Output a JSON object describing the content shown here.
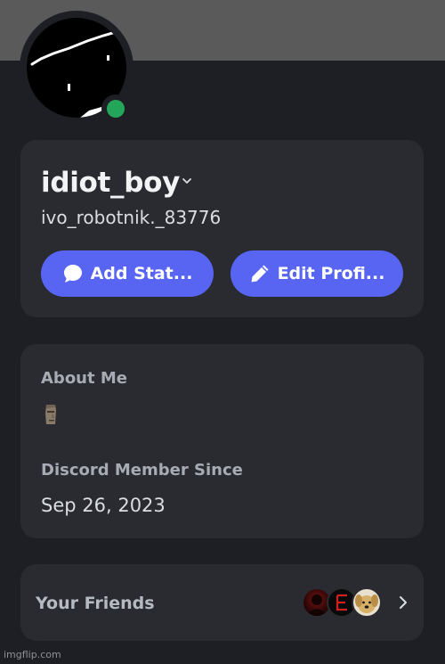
{
  "profile": {
    "display_name": "idiot_boy",
    "username": "ivo_robotnik._83776",
    "status": "online",
    "status_color": "#23a55a",
    "banner_color": "#5a5a5a"
  },
  "buttons": {
    "add_status": "Add Stat...",
    "edit_profile": "Edit Profi..."
  },
  "about": {
    "heading": "About Me",
    "bio_icon": "moai-emoji-icon",
    "member_since_heading": "Discord Member Since",
    "member_since_date": "Sep 26, 2023"
  },
  "friends": {
    "label": "Your Friends",
    "avatar_icons": [
      "dark-red-avatar",
      "letter-e-avatar",
      "dog-avatar"
    ]
  },
  "watermark": "imgflip.com",
  "colors": {
    "accent": "#5865f2",
    "background": "#1e1f25",
    "card": "#2a2b31"
  }
}
